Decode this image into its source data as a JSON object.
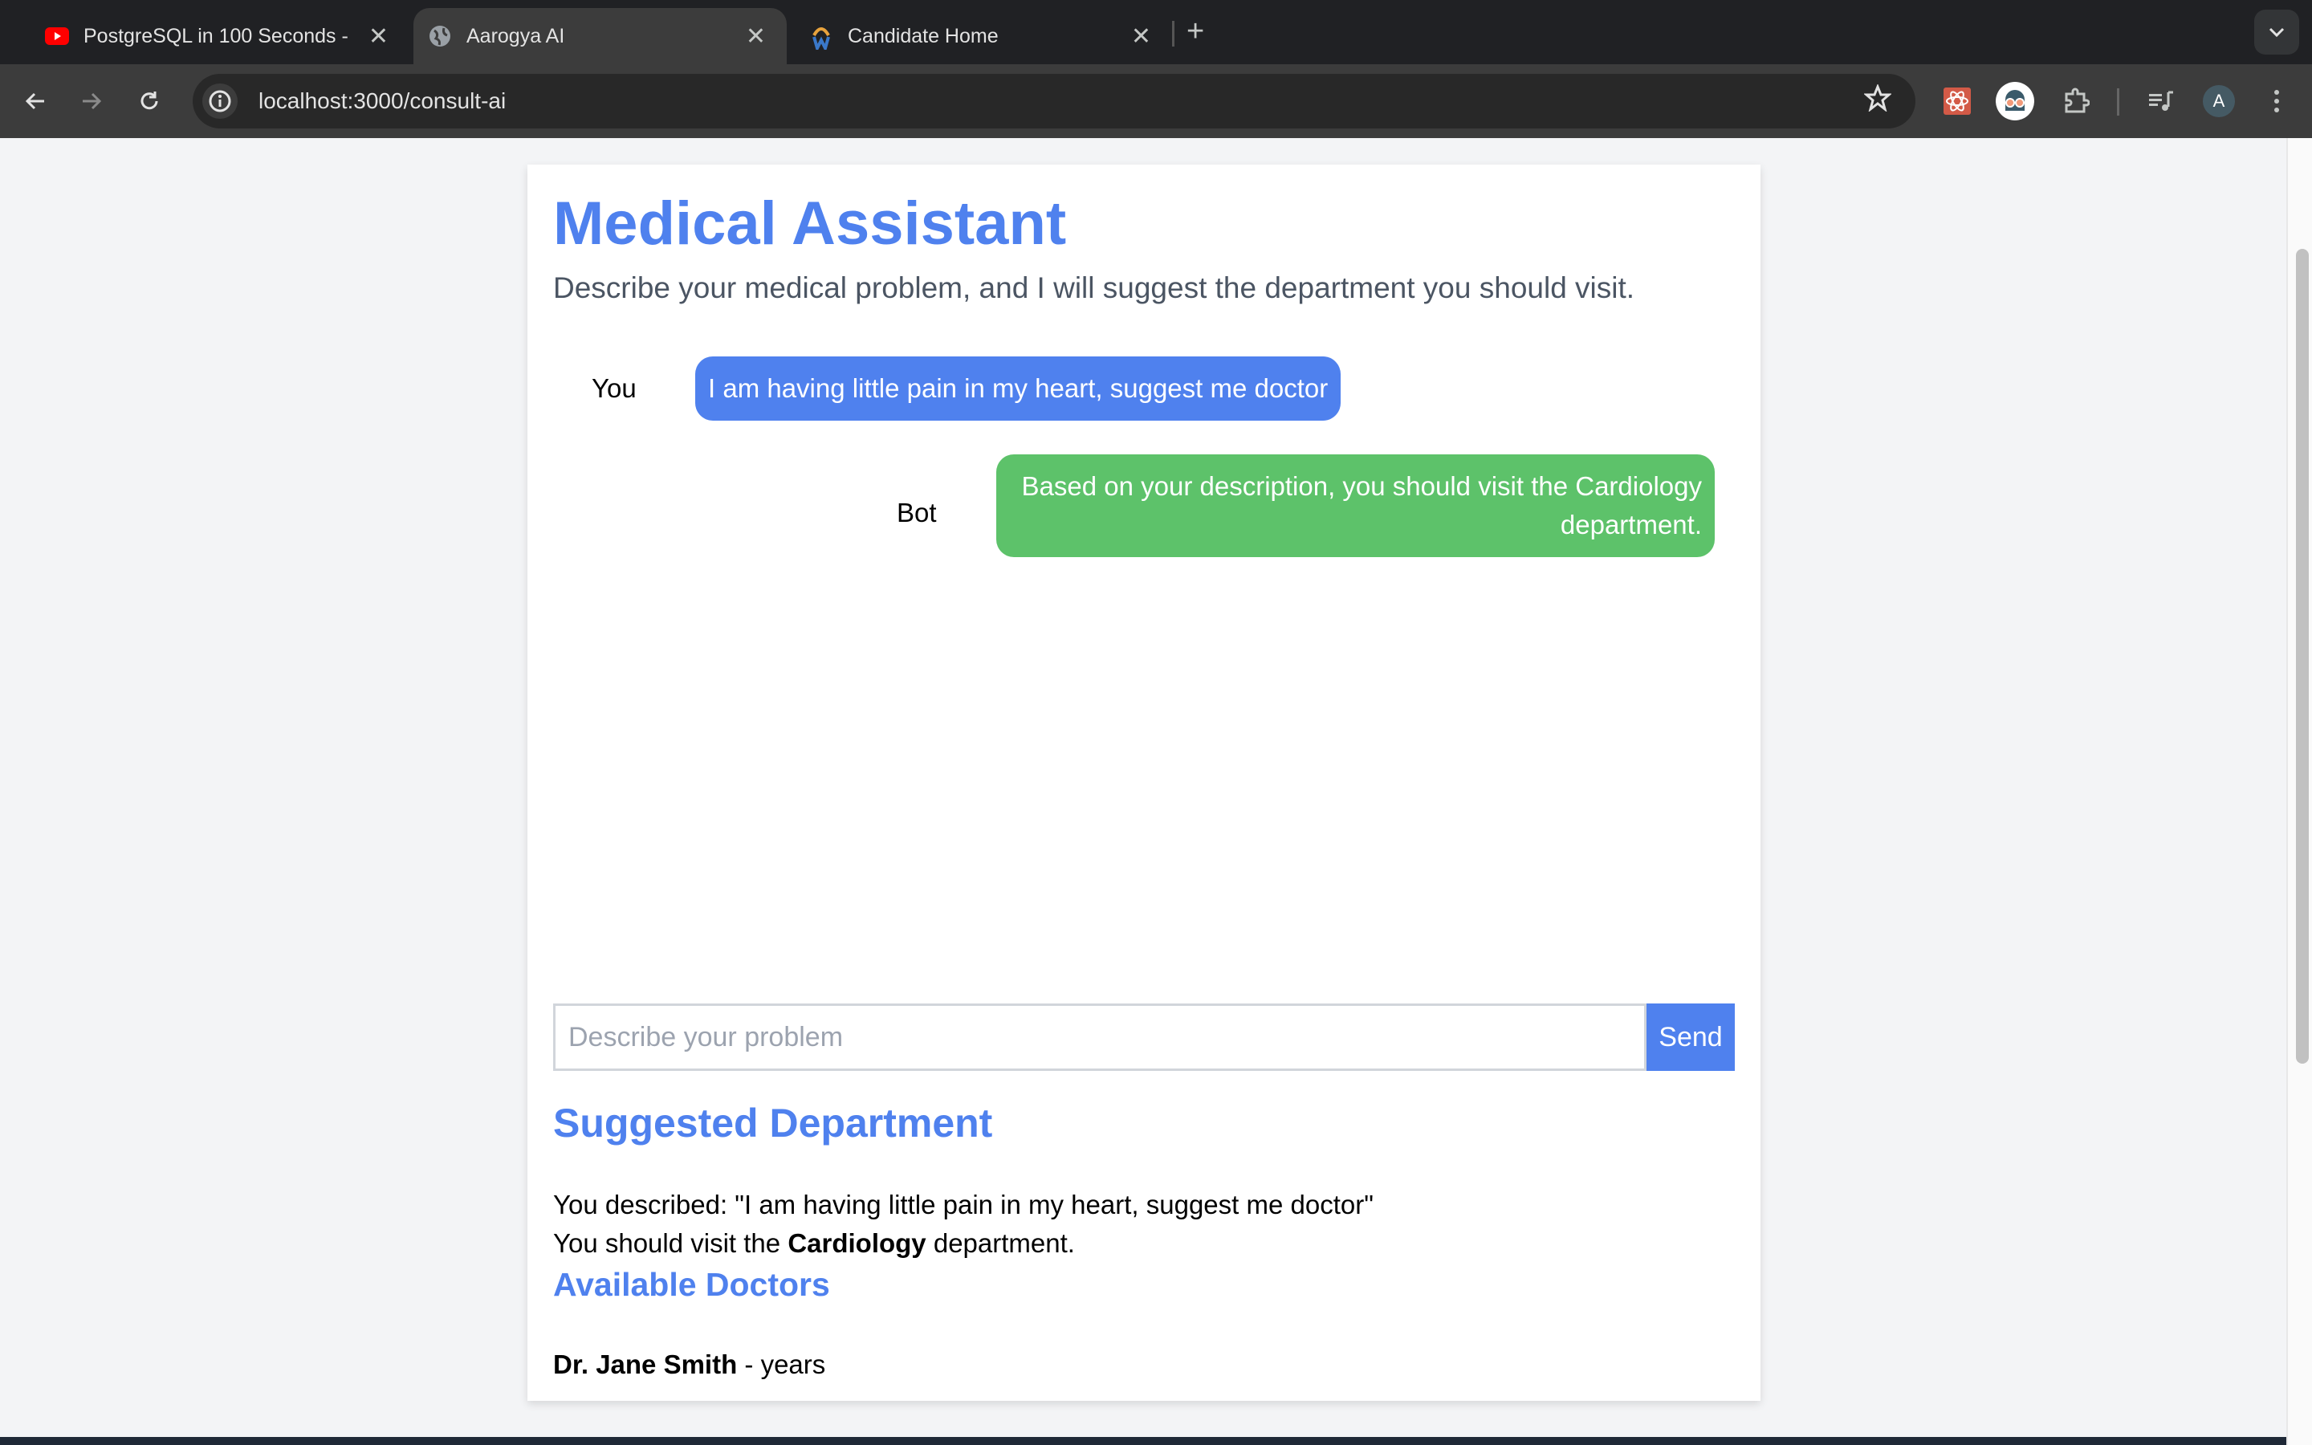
{
  "browser": {
    "tabs": [
      {
        "title": "PostgreSQL in 100 Seconds - ",
        "icon": "youtube-icon",
        "active": false
      },
      {
        "title": "Aarogya AI",
        "icon": "globe-icon",
        "active": true
      },
      {
        "title": "Candidate Home",
        "icon": "candidate-site-icon",
        "active": false
      }
    ],
    "close_glyph": "✕",
    "new_tab_glyph": "+",
    "tab_list_glyph": "⌄",
    "url": "localhost:3000/consult-ai",
    "profile_initial": "A"
  },
  "page": {
    "title": "Medical Assistant",
    "subtitle": "Describe your medical problem, and I will suggest the department you should visit.",
    "messages": [
      {
        "sender": "You",
        "text": "I am having little pain in my heart, suggest me doctor",
        "color": "#4f81ee"
      },
      {
        "sender": "Bot",
        "text": "Based on your description, you should visit the Cardiology department.",
        "color": "#5dc26a"
      }
    ],
    "input": {
      "value": "",
      "placeholder": "Describe your problem"
    },
    "send_label": "Send",
    "suggested": {
      "heading": "Suggested Department",
      "described_prefix": "You described: ",
      "described_text": "\"I am having little pain in my heart, suggest me doctor\"",
      "visit_prefix": "You should visit the ",
      "department": "Cardiology",
      "visit_suffix": " department."
    },
    "doctors": {
      "heading": "Available Doctors",
      "list": [
        {
          "name": "Dr. Jane Smith",
          "detail": " - years"
        }
      ]
    }
  },
  "colors": {
    "accent": "#4f81ee",
    "bot_bubble": "#5dc26a",
    "page_bg": "#f3f4f6"
  }
}
